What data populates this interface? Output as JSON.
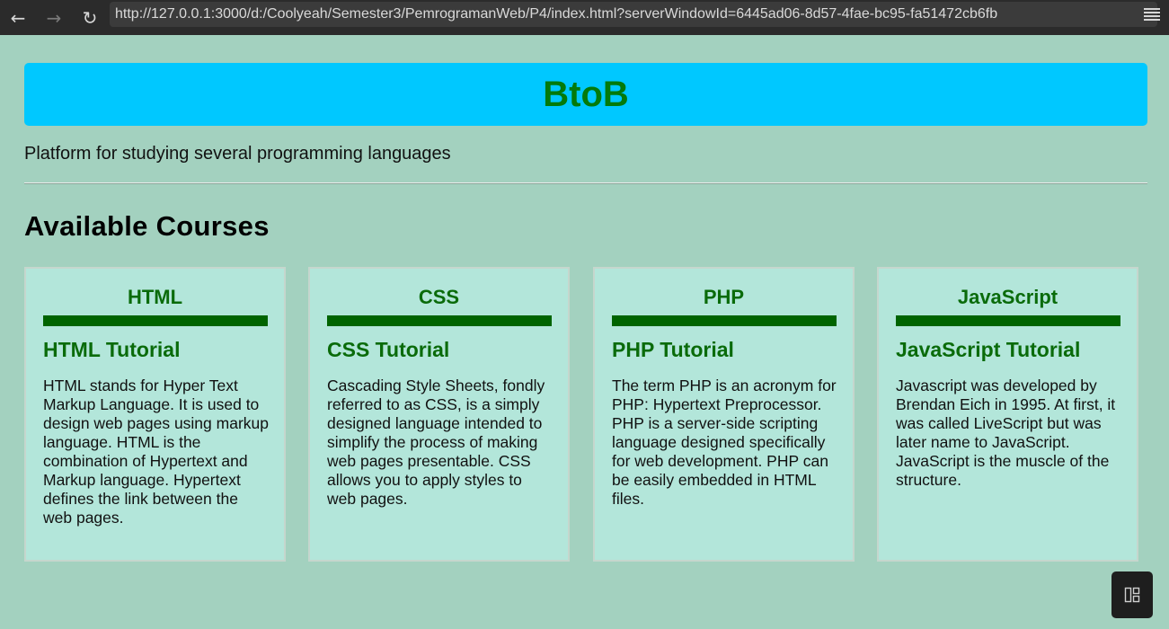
{
  "browser": {
    "back_icon": "←",
    "forward_icon": "→",
    "reload_icon": "↻",
    "url": "http://127.0.0.1:3000/d:/Coolyeah/Semester3/PemrogramanWeb/P4/index.html?serverWindowId=6445ad06-8d57-4fae-bc95-fa51472cb6fb"
  },
  "header": {
    "brand": "BtoB",
    "tagline": "Platform for studying several programming languages"
  },
  "main": {
    "section_title": "Available Courses",
    "courses": [
      {
        "title": "HTML",
        "subtitle": "HTML Tutorial",
        "description": "HTML stands for Hyper Text Markup Language. It is used to design web pages using markup language. HTML is the combination of Hypertext and Markup language. Hypertext defines the link between the web pages."
      },
      {
        "title": "CSS",
        "subtitle": "CSS Tutorial",
        "description": "Cascading Style Sheets, fondly referred to as CSS, is a simply designed language intended to simplify the process of making web pages presentable. CSS allows you to apply styles to web pages."
      },
      {
        "title": "PHP",
        "subtitle": "PHP Tutorial",
        "description": "The term PHP is an acronym for PHP: Hypertext Preprocessor. PHP is a server-side scripting language designed specifically for web development. PHP can be easily embedded in HTML files."
      },
      {
        "title": "JavaScript",
        "subtitle": "JavaScript Tutorial",
        "description": "Javascript was developed by Brendan Eich in 1995. At first, it was called LiveScript but was later name to JavaScript. JavaScript is the muscle of the structure."
      }
    ]
  },
  "colors": {
    "page_background": "#a3d1bf",
    "header_background": "#00c8ff",
    "brand_green": "#047a0a",
    "card_background": "#b3e6da",
    "card_bar": "#006400"
  }
}
